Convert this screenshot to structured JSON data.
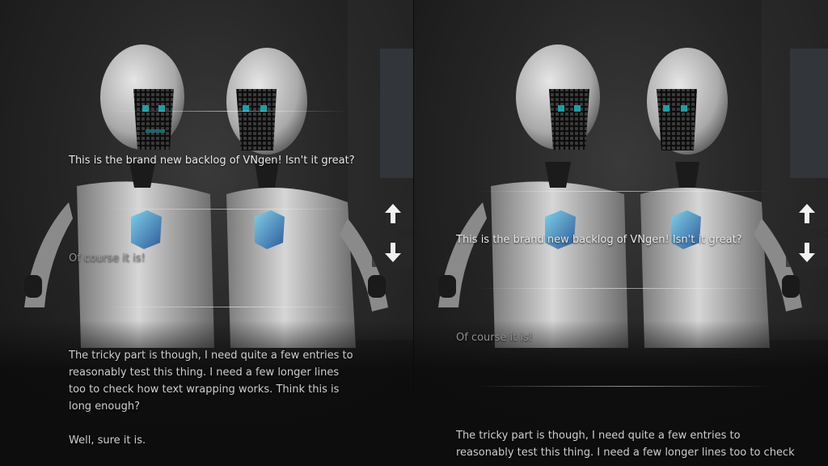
{
  "left_panel": {
    "entries": [
      "This is the brand new backlog of VNgen! Isn't it great?",
      "Of course it is!",
      "The tricky part is though, I need quite a few entries to\nreasonably test this thing. I need a few longer lines\ntoo to check how text wrapping works. Think this is\nlong enough?\n\nWell, sure it is."
    ]
  },
  "right_panel": {
    "entries": [
      "This is the brand new backlog of VNgen! Isn't it great?",
      "Of course it is!",
      "The tricky part is though, I need quite a few entries to\nreasonably test this thing. I need a few longer lines too to check"
    ]
  },
  "icons": {
    "scroll_up": "arrow-up-icon",
    "scroll_down": "arrow-down-icon"
  },
  "colors": {
    "text": "#e9e9e9",
    "text_dim": "#8f8f8f",
    "face_screen": "#1aa0a8",
    "core_cube": "#5ab0d0"
  }
}
